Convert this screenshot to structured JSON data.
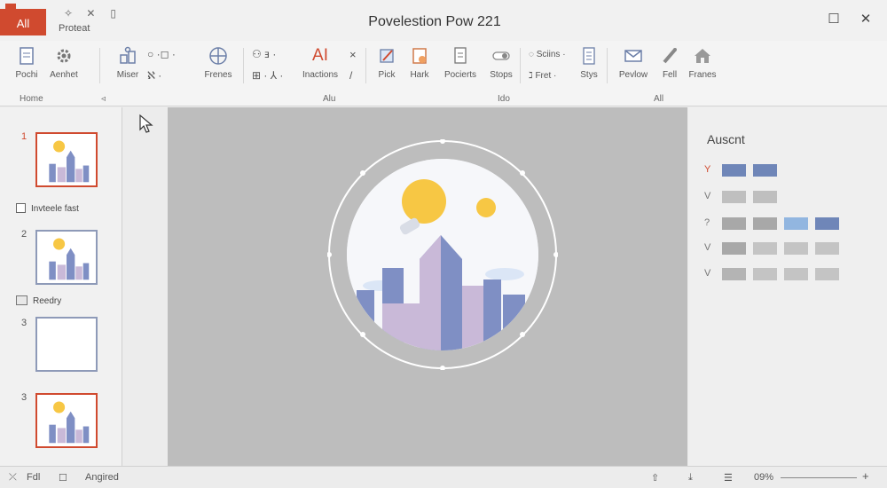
{
  "app": {
    "tab_label": "All",
    "protect_label": "Proteat",
    "title": "Povelestion Pow 221"
  },
  "ribbon": {
    "buttons": [
      {
        "label": "Pochi",
        "icon": "document-icon"
      },
      {
        "label": "Aenhet",
        "icon": "gear-icon"
      },
      {
        "label": "Miser",
        "icon": "shapes-icon"
      },
      {
        "label": "Frenes",
        "icon": "crosshair-circle-icon"
      },
      {
        "label": "Inactions",
        "icon": "text-ai-icon"
      },
      {
        "label": "Pick",
        "icon": "pen-pick-icon"
      },
      {
        "label": "Hark",
        "icon": "picture-icon"
      },
      {
        "label": "Pocierts",
        "icon": "document-list-icon"
      },
      {
        "label": "Stops",
        "icon": "toggle-icon"
      },
      {
        "label": "Stys",
        "icon": "page-lines-icon"
      },
      {
        "label": "Pevlow",
        "icon": "envelope-icon"
      },
      {
        "label": "Fell",
        "icon": "pencil-icon"
      },
      {
        "label": "Franes",
        "icon": "house-icon"
      }
    ],
    "small": {
      "shapes_row": "○ ·◻ ·",
      "draw_row": "ℵ ·",
      "arrange_row": "⊞ · ⅄ ·",
      "ai_label": "AI",
      "scenes": "Sciins",
      "fret": "Fret",
      "close_mark": "×"
    },
    "groups": [
      "Home",
      "Alu",
      "Ido",
      "All"
    ]
  },
  "slides": [
    {
      "number": "1",
      "type": "art",
      "active": true
    },
    {
      "number": "2",
      "type": "art",
      "active": false
    },
    {
      "number": "3",
      "type": "blank",
      "active": false
    },
    {
      "number": "3",
      "type": "art",
      "active": true
    }
  ],
  "sections": {
    "first": "Invteele fast",
    "second": "Reedry"
  },
  "right_pane": {
    "title": "Auscnt",
    "rows": [
      {
        "mark": "Y",
        "swatches": [
          "#6f86b8",
          "#6f86b8"
        ]
      },
      {
        "mark": "V",
        "swatches": [
          "#bfbfbf",
          "#bfbfbf"
        ]
      },
      {
        "mark": "?",
        "swatches": [
          "#a8a8a8",
          "#a8a8a8",
          "#92b6e0",
          "#6f86b8"
        ]
      },
      {
        "mark": "V",
        "swatches": [
          "#a8a8a8",
          "#c4c4c4",
          "#c4c4c4",
          "#c4c4c4"
        ]
      },
      {
        "mark": "V",
        "swatches": [
          "#b4b4b4",
          "#c4c4c4",
          "#c4c4c4",
          "#c4c4c4"
        ]
      }
    ]
  },
  "status": {
    "slide_label": "Fdl",
    "notes_label": "Angired",
    "zoom": "09%"
  },
  "colors": {
    "accent": "#d04a2f",
    "canvas": "#bdbdbd",
    "sun": "#f7c744",
    "building": "#7f8fc4"
  }
}
